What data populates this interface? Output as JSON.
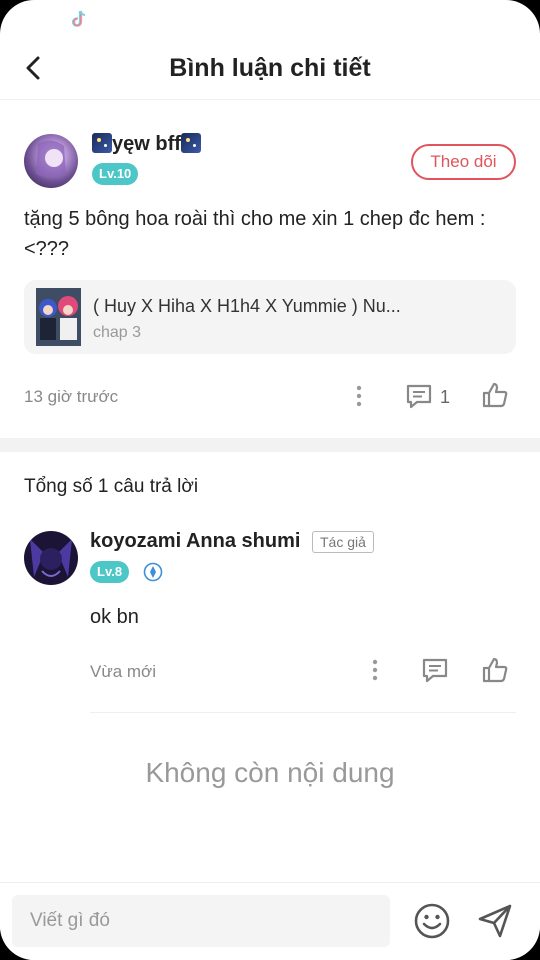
{
  "header": {
    "title": "Bình luận chi tiết"
  },
  "comment": {
    "author_name": "yęw bff",
    "level": "Lv.10",
    "follow_label": "Theo dõi",
    "text": "tặng 5 bông hoa roài thì cho me xin 1 chep đc hem :<???",
    "story": {
      "title": "( Huy X Hiha X H1h4 X Yummie ) Nu...",
      "chapter": "chap 3"
    },
    "time": "13 giờ trước",
    "reply_count": "1"
  },
  "replies_section": {
    "title": "Tổng số 1 câu trả lời"
  },
  "reply": {
    "author_name": "koyozami Anna shumi",
    "author_tag": "Tác giả",
    "level": "Lv.8",
    "text": "ok bn",
    "time": "Vừa mới"
  },
  "empty_state": "Không còn nội dung",
  "composer": {
    "placeholder": "Viết gì đó"
  },
  "colors": {
    "accent": "#e0545c",
    "level_badge": "#4cc6c6"
  },
  "icons": [
    "tiktok-icon",
    "back-arrow-icon",
    "more-icon",
    "comment-icon",
    "like-icon",
    "verified-icon",
    "emoji-icon",
    "send-icon"
  ]
}
